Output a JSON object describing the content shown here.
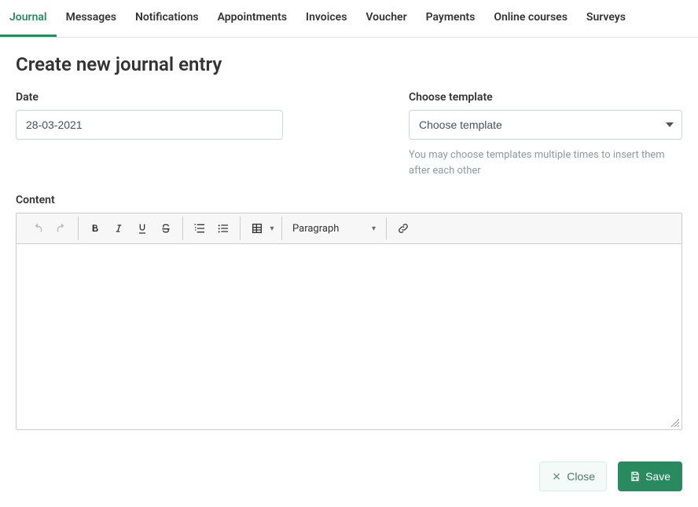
{
  "tabs": [
    {
      "label": "Journal",
      "active": true
    },
    {
      "label": "Messages",
      "active": false
    },
    {
      "label": "Notifications",
      "active": false
    },
    {
      "label": "Appointments",
      "active": false
    },
    {
      "label": "Invoices",
      "active": false
    },
    {
      "label": "Voucher",
      "active": false
    },
    {
      "label": "Payments",
      "active": false
    },
    {
      "label": "Online courses",
      "active": false
    },
    {
      "label": "Surveys",
      "active": false
    }
  ],
  "page": {
    "title": "Create new journal entry"
  },
  "form": {
    "date": {
      "label": "Date",
      "value": "28-03-2021"
    },
    "template": {
      "label": "Choose template",
      "placeholder": "Choose template",
      "help": "You may choose templates multiple times to insert them after each other"
    },
    "content": {
      "label": "Content",
      "paragraph_label": "Paragraph"
    }
  },
  "actions": {
    "close": "Close",
    "save": "Save"
  }
}
